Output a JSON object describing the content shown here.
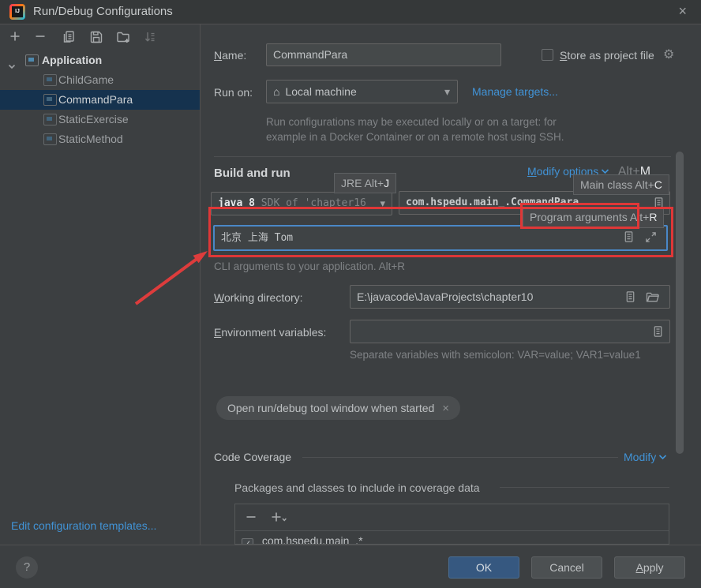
{
  "titlebar": {
    "title": "Run/Debug Configurations"
  },
  "icons": {
    "close": "×",
    "chip_close": "×",
    "gear": "⚙",
    "home": "⌂",
    "dropdown_caret": "▾",
    "check": "✓",
    "help": "?",
    "logo_text": "IJ"
  },
  "sidebar": {
    "toolbar_icons": [
      "add",
      "remove",
      "copy-configuration",
      "save-configuration",
      "new-folder",
      "sort-configurations"
    ],
    "tree": {
      "root_label": "Application",
      "items": [
        {
          "label": "ChildGame",
          "selected": false
        },
        {
          "label": "CommandPara",
          "selected": true
        },
        {
          "label": "StaticExercise",
          "selected": false
        },
        {
          "label": "StaticMethod",
          "selected": false
        }
      ]
    },
    "edit_templates_link": "Edit configuration templates..."
  },
  "form": {
    "name_label": "Name:",
    "name_value": "CommandPara",
    "store_as_project_file_label": "Store as project file",
    "run_on_label": "Run on:",
    "run_on_value": "Local machine",
    "manage_targets_link": "Manage targets...",
    "run_on_help_line1": "Run configurations may be executed locally or on a target: for",
    "run_on_help_line2": "example in a Docker Container or on a remote host using SSH.",
    "build_and_run_label": "Build and run",
    "modify_options": {
      "label": "Modify options",
      "shortcut_prefix": "Alt+",
      "shortcut_key": "M"
    },
    "jre_hint": {
      "label": "JRE",
      "shortcut_prefix": "Alt+",
      "shortcut_key": "J"
    },
    "main_class_hint": {
      "label": "Main class",
      "shortcut_prefix": "Alt+",
      "shortcut_key": "C"
    },
    "jdk_value_primary": "java 8",
    "jdk_value_secondary": "SDK of 'chapter16",
    "main_class_value": "com.hspedu.main_.CommandPara",
    "program_args_hint": {
      "label": "Program arguments",
      "shortcut_prefix": "Alt+",
      "shortcut_key": "R"
    },
    "program_args_value": "北京 上海 Tom",
    "cli_help": "CLI arguments to your application. Alt+R",
    "working_directory_label": "Working directory:",
    "working_directory_value": "E:\\javacode\\JavaProjects\\chapter10",
    "environment_variables_label": "Environment variables:",
    "environment_variables_value": "",
    "environment_variables_help": "Separate variables with semicolon: VAR=value; VAR1=value1",
    "chip_label": "Open run/debug tool window when started",
    "code_coverage_label": "Code Coverage",
    "coverage_modify_link": "Modify",
    "packages_header": "Packages and classes to include in coverage data",
    "coverage_item": "com.hspedu.main_.*"
  },
  "footer": {
    "ok": "OK",
    "cancel": "Cancel",
    "apply": "Apply"
  },
  "colors": {
    "accent_link": "#4193d6",
    "tree_selection": "#15324e",
    "annotation_red": "#df3737",
    "focus_border": "#4a88c7",
    "ok_button": "#365880"
  }
}
